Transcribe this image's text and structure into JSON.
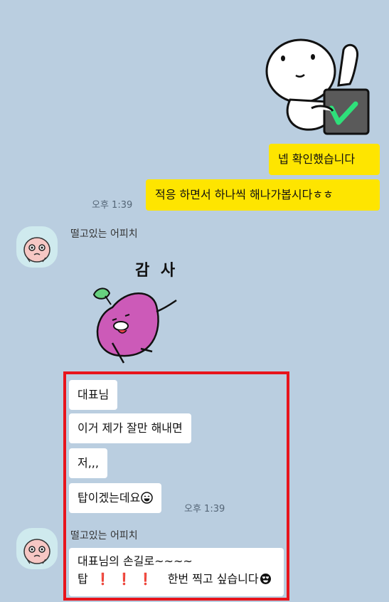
{
  "messages_me": [
    {
      "text": "넵 확인했습니다"
    },
    {
      "text": "적응 하면서 하나씩 해나가봅시다ㅎㅎ",
      "time": "오후 1:39"
    }
  ],
  "sender_1": {
    "name": "떨고있는 어피치",
    "sticker_text": "감 사"
  },
  "messages_other": [
    {
      "text": "대표님"
    },
    {
      "text": "이거 제가 잘만 해내면"
    },
    {
      "text": "저,,,"
    },
    {
      "text": "탑이겠는데요",
      "emoji": "grinning-face-icon",
      "time": "오후 1:39"
    }
  ],
  "sender_2": {
    "name": "떨고있는 어피치"
  },
  "last_message": {
    "line1": "대표님의 손길로~~~~",
    "line2_a": "탑",
    "line2_b": "한번 찍고 싶습니다",
    "emoji": "heart-eyes-face-icon"
  },
  "colors": {
    "background": "#bacee0",
    "my_bubble": "#fee500",
    "highlight": "#e8141c"
  }
}
